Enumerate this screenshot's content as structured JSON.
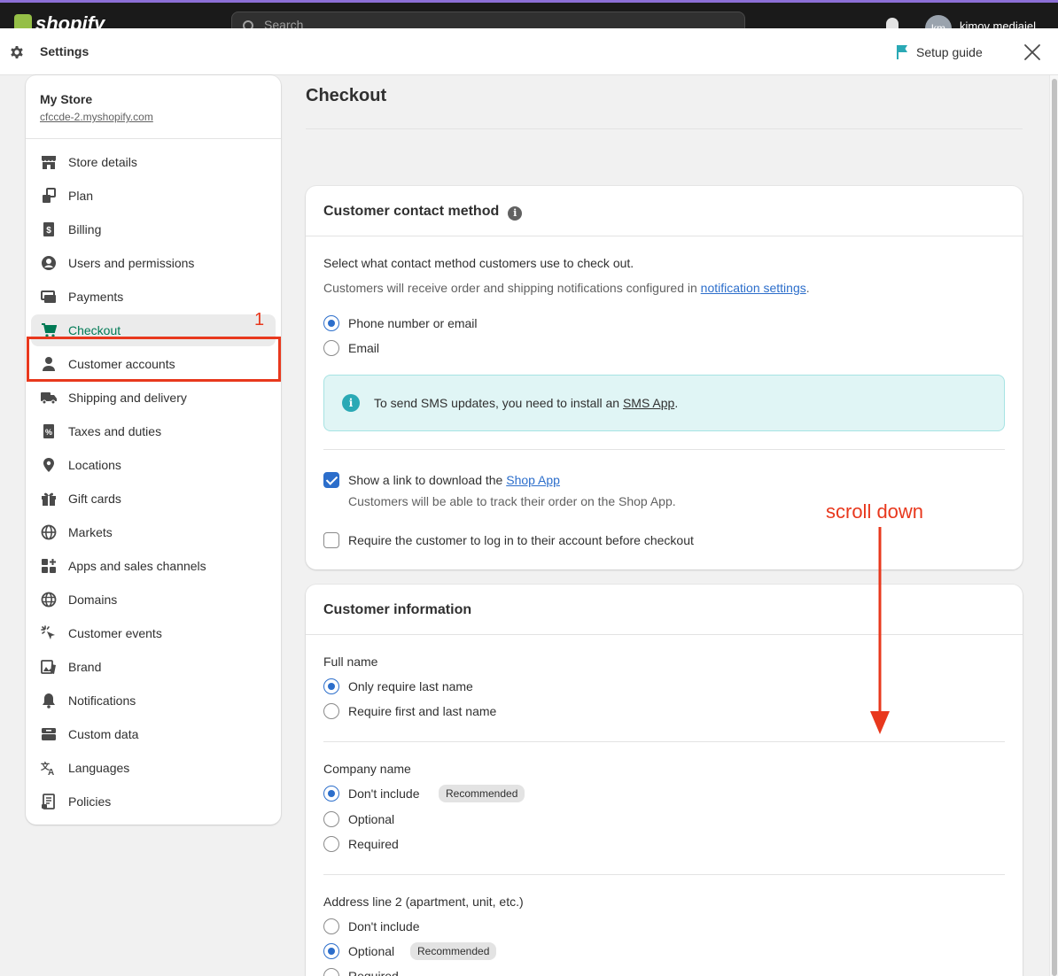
{
  "topbar": {
    "brand": "shopify",
    "search_placeholder": "Search",
    "avatar_initials": "km",
    "user_name": "kimov mediajel"
  },
  "modal": {
    "title": "Settings",
    "setup_guide": "Setup guide"
  },
  "sidebar": {
    "store_name": "My Store",
    "store_url": "cfccde-2.myshopify.com",
    "items": [
      {
        "label": "Store details",
        "icon": "store-icon"
      },
      {
        "label": "Plan",
        "icon": "plan-icon"
      },
      {
        "label": "Billing",
        "icon": "billing-icon"
      },
      {
        "label": "Users and permissions",
        "icon": "user-circle-icon"
      },
      {
        "label": "Payments",
        "icon": "payments-icon"
      },
      {
        "label": "Checkout",
        "icon": "cart-icon"
      },
      {
        "label": "Customer accounts",
        "icon": "person-icon"
      },
      {
        "label": "Shipping and delivery",
        "icon": "truck-icon"
      },
      {
        "label": "Taxes and duties",
        "icon": "tax-icon"
      },
      {
        "label": "Locations",
        "icon": "location-pin-icon"
      },
      {
        "label": "Gift cards",
        "icon": "gift-icon"
      },
      {
        "label": "Markets",
        "icon": "globe-icon"
      },
      {
        "label": "Apps and sales channels",
        "icon": "apps-icon"
      },
      {
        "label": "Domains",
        "icon": "domains-globe-icon"
      },
      {
        "label": "Customer events",
        "icon": "cursor-click-icon"
      },
      {
        "label": "Brand",
        "icon": "brand-icon"
      },
      {
        "label": "Notifications",
        "icon": "bell-icon"
      },
      {
        "label": "Custom data",
        "icon": "database-icon"
      },
      {
        "label": "Languages",
        "icon": "translate-icon"
      },
      {
        "label": "Policies",
        "icon": "policy-icon"
      }
    ],
    "active_index": 5,
    "annotation_number": "1"
  },
  "page": {
    "title": "Checkout"
  },
  "contact_card": {
    "title": "Customer contact method",
    "description": "Select what contact method customers use to check out.",
    "notice_prefix": "Customers will receive order and shipping notifications configured in ",
    "notice_link": "notification settings",
    "notice_suffix": ".",
    "options": [
      "Phone number or email",
      "Email"
    ],
    "selected": "Phone number or email",
    "sms_prefix": "To send SMS updates, you need to install an ",
    "sms_link": "SMS App",
    "sms_suffix": ".",
    "shop_app_prefix": "Show a link to download the ",
    "shop_app_link": "Shop App",
    "shop_app_checked": true,
    "shop_app_help": "Customers will be able to track their order on the Shop App.",
    "require_login_label": "Require the customer to log in to their account before checkout",
    "require_login_checked": false
  },
  "info_card": {
    "title": "Customer information",
    "full_name": {
      "label": "Full name",
      "options": [
        "Only require last name",
        "Require first and last name"
      ],
      "selected": "Only require last name"
    },
    "company_name": {
      "label": "Company name",
      "options": [
        "Don't include",
        "Optional",
        "Required"
      ],
      "selected": "Don't include",
      "badge": "Recommended"
    },
    "address_line2": {
      "label": "Address line 2 (apartment, unit, etc.)",
      "options": [
        "Don't include",
        "Optional",
        "Required"
      ],
      "selected": "Optional",
      "badge": "Recommended"
    }
  },
  "annotation": {
    "text": "scroll down",
    "color": "#e8381d"
  },
  "colors": {
    "accent_green": "#007a55",
    "link_blue": "#2c6ecb",
    "annotation_red": "#e8381d",
    "banner_bg": "#e0f5f5"
  }
}
